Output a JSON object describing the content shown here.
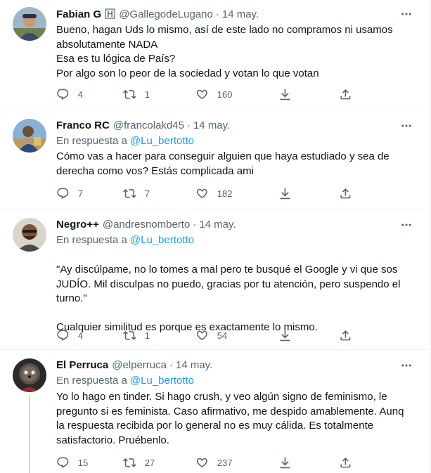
{
  "tweets": [
    {
      "name": "Fabian G",
      "badge_glyph": "╠",
      "handle": "@GallegodeLugano",
      "separator": "·",
      "date": "14 may.",
      "reply_prefix": "",
      "reply_mention": "",
      "lines": [
        "Bueno, hagan Uds lo mismo, así de este lado no compramos ni usamos",
        "absolutamente NADA",
        "Esa es tu lógica de País?",
        "Por algo son lo peor de la sociedad y votan lo que votan"
      ],
      "replies": "4",
      "retweets": "1",
      "likes": "160"
    },
    {
      "name": "Franco RC",
      "handle": "@francolakd45",
      "separator": "·",
      "date": "14 may.",
      "reply_prefix": "En respuesta a",
      "reply_mention": "@Lu_bertotto",
      "lines": [
        "Cómo vas a hacer para conseguir alguien que haya estudiado y sea de",
        "derecha como vos? Estás complicada ami"
      ],
      "replies": "7",
      "retweets": "7",
      "likes": "182"
    },
    {
      "name": "Negro++",
      "handle": "@andresnomberto",
      "separator": "·",
      "date": "14 may.",
      "reply_prefix": "En respuesta a",
      "reply_mention": "@Lu_bertotto",
      "lines": [
        "\"Ay discúlpame, no lo tomes a mal pero te busqué el Google y vi que sos",
        "JUDÍO. Mil disculpas no puedo, gracias por tu atención, pero suspendo el",
        "turno.\"",
        "",
        "Cualquier similitud es porque es exactamente lo mismo."
      ],
      "replies": "4",
      "retweets": "1",
      "likes": "54"
    },
    {
      "name": "El Perruca",
      "handle": "@elperruca",
      "separator": "·",
      "date": "14 may.",
      "reply_prefix": "En respuesta a",
      "reply_mention": "@Lu_bertotto",
      "lines": [
        "Yo lo hago en tinder. Si hago crush, y veo algún signo de feminismo, le",
        "pregunto si es feminista. Caso afirmativo, me despido amablemente. Aunq",
        "la respuesta recibida por lo general no es muy cálida. Es totalmente",
        "satisfactorio. Pruébenlo."
      ],
      "replies": "15",
      "retweets": "27",
      "likes": "237"
    }
  ],
  "icons": {
    "reply": "reply-icon",
    "retweet": "retweet-icon",
    "like": "heart-icon",
    "download": "download-icon",
    "share": "share-icon",
    "more": "more-icon"
  },
  "colors": {
    "text": "#0f1419",
    "secondary": "#536471",
    "link": "#1d9bf0",
    "divider": "#eff3f4"
  }
}
